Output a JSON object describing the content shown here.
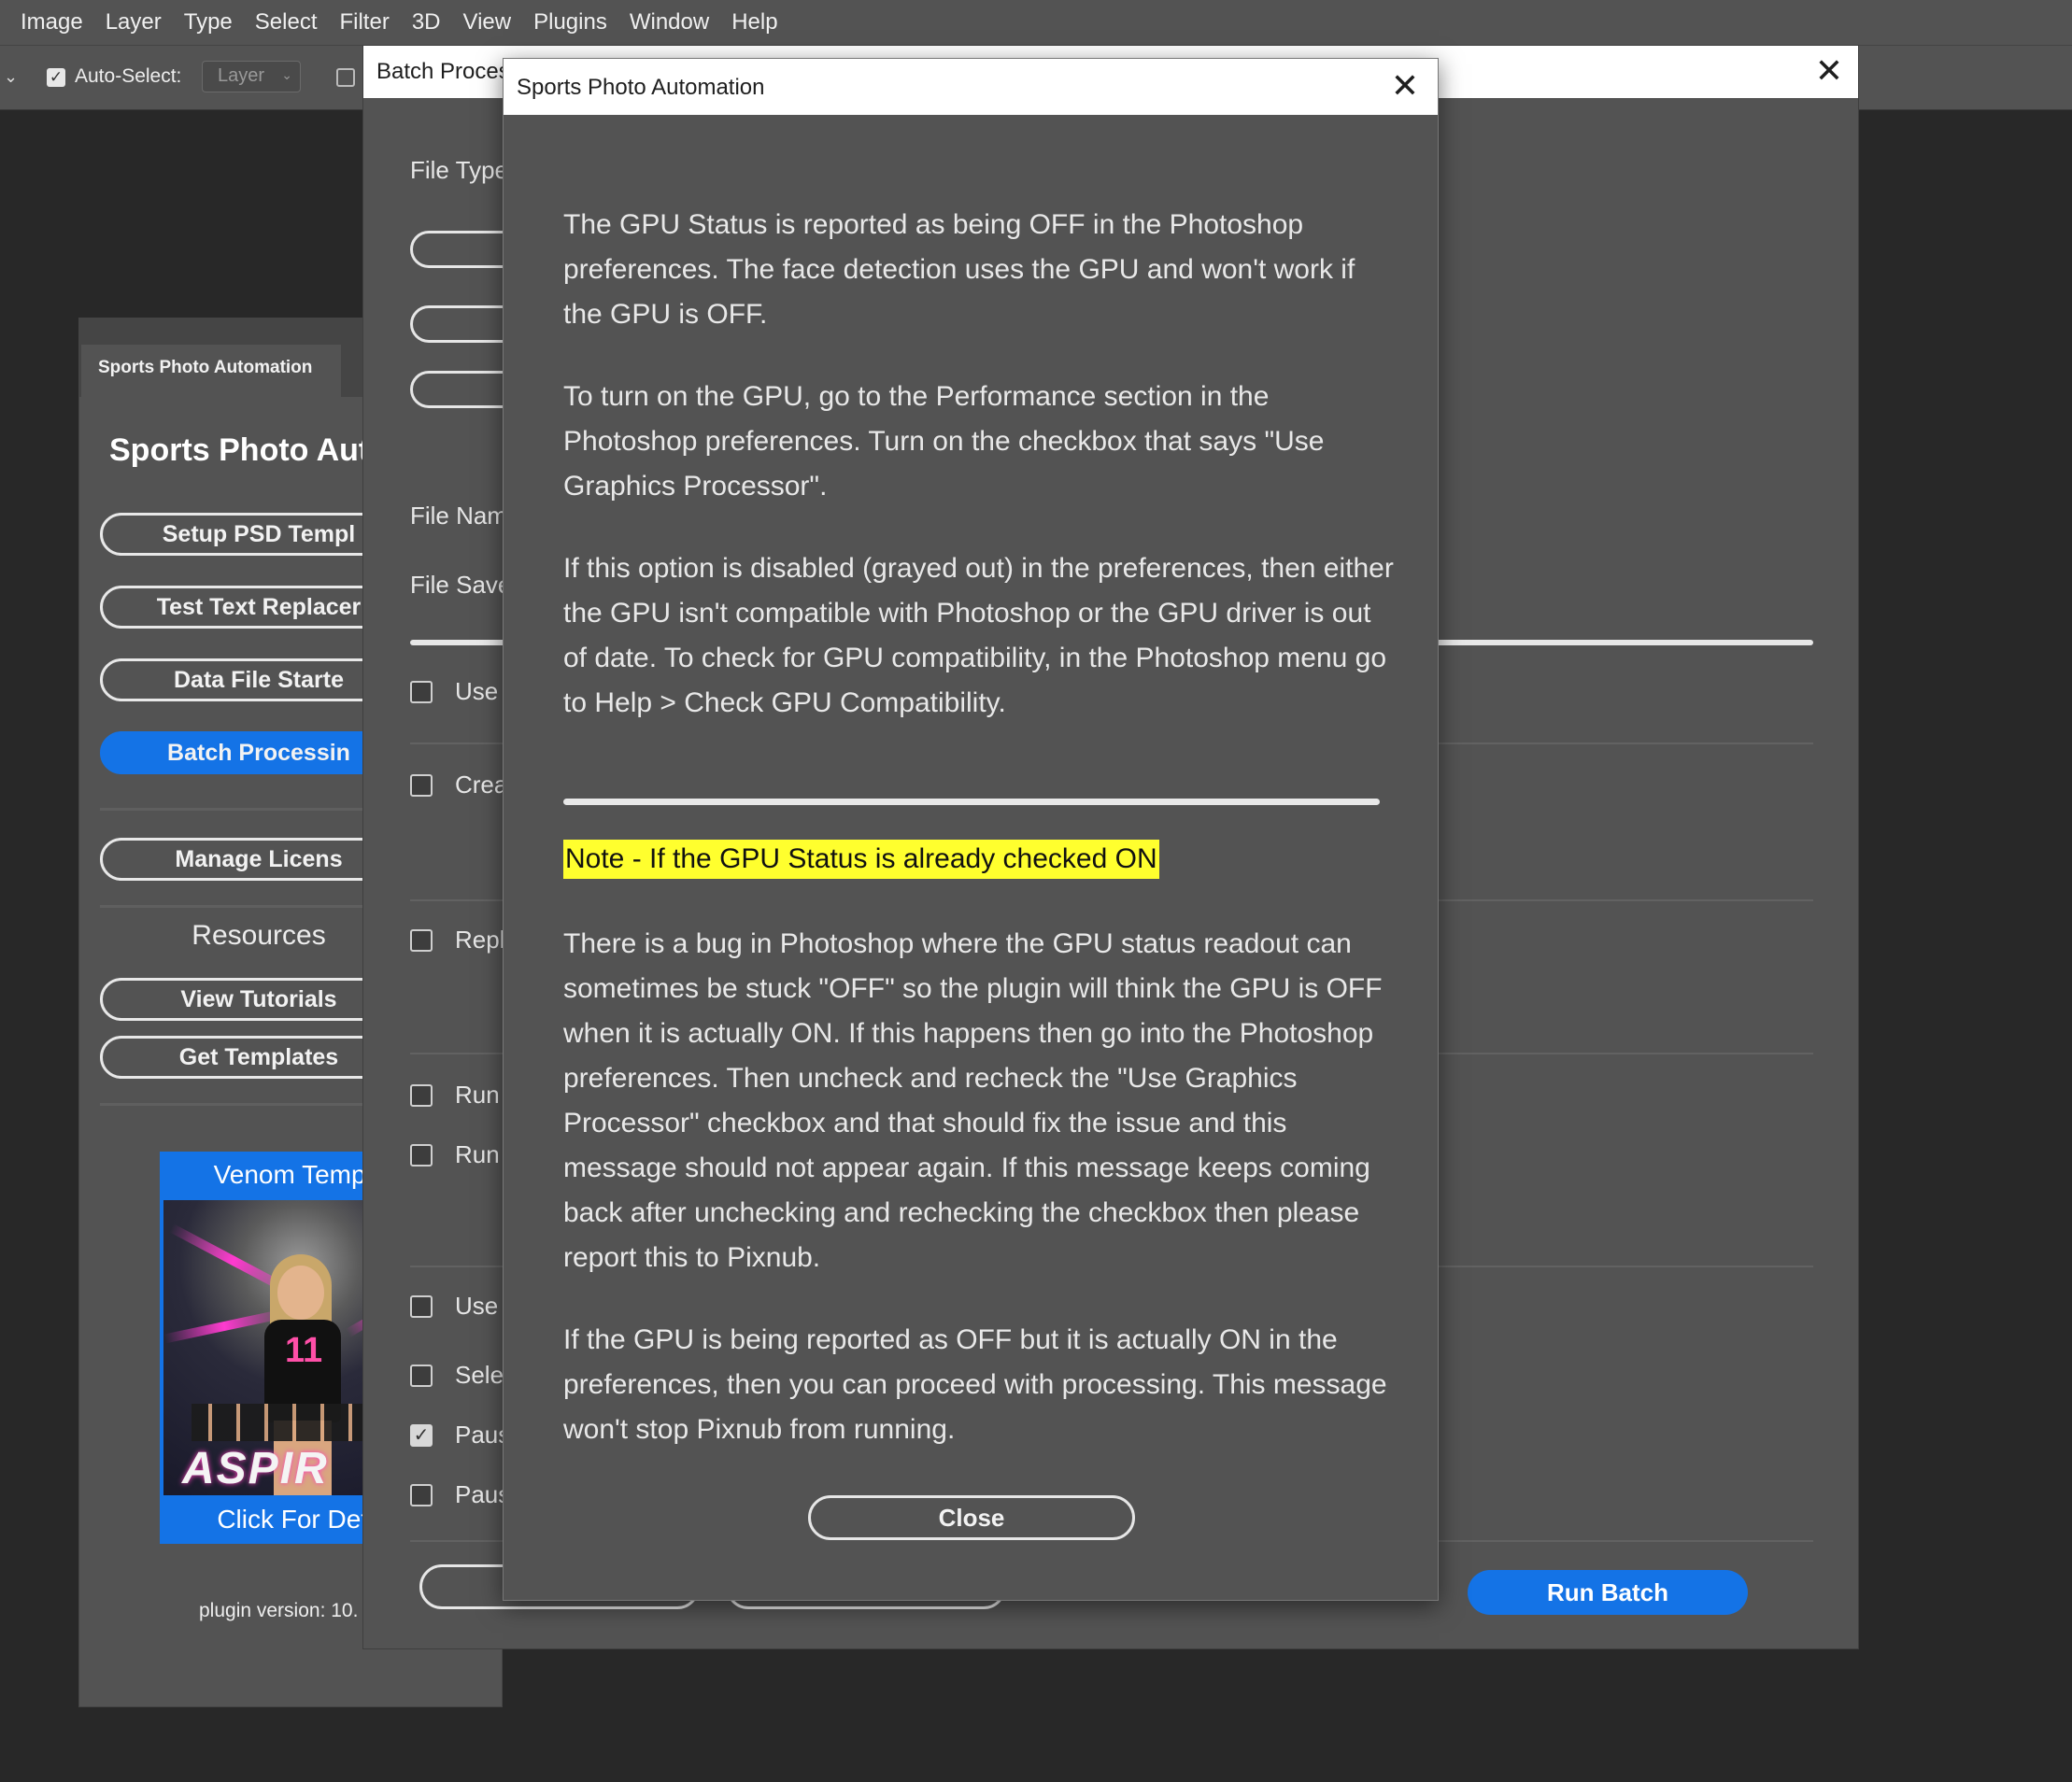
{
  "menubar": {
    "items": [
      "Image",
      "Layer",
      "Type",
      "Select",
      "Filter",
      "3D",
      "View",
      "Plugins",
      "Window",
      "Help"
    ]
  },
  "options_bar": {
    "auto_select_label": "Auto-Select:",
    "auto_select_checked": true,
    "layer_select_value": "Layer"
  },
  "plugin_panel": {
    "tab_label": "Sports Photo Automation",
    "heading": "Sports Photo Autc",
    "buttons": [
      {
        "label": "Setup PSD Templ"
      },
      {
        "label": "Test Text Replacer"
      },
      {
        "label": "Data File Starte"
      },
      {
        "label": "Batch Processin",
        "active": true
      },
      {
        "label": "Manage Licens"
      }
    ],
    "resources_label": "Resources",
    "resource_buttons": [
      "View Tutorials",
      "Get Templates"
    ],
    "promo": {
      "title": "Venom Templa",
      "cta": "Click For Deta",
      "image_text": "ASPIR"
    },
    "version": "plugin version: 10."
  },
  "batch_window": {
    "title": "Batch Proces",
    "labels": {
      "file_type": "File Type",
      "file_name": "File Nam",
      "file_save": "File Save"
    },
    "checkboxes": [
      {
        "label": "Use",
        "checked": false
      },
      {
        "label": "Crea",
        "checked": false
      },
      {
        "label": "Repl",
        "checked": false
      },
      {
        "label": "Run",
        "checked": false
      },
      {
        "label": "Run",
        "checked": false
      },
      {
        "label": "Use",
        "checked": false
      },
      {
        "label": "Selec",
        "checked": false
      },
      {
        "label": "Paus",
        "checked": true
      },
      {
        "label": "Paus",
        "checked": false
      }
    ],
    "run_batch_label": "Run Batch"
  },
  "modal": {
    "title": "Sports Photo Automation",
    "paragraphs": [
      "The GPU Status is reported as being OFF in the Photoshop preferences. The face detection uses the GPU and won't work if the GPU is OFF.",
      "To turn on the GPU, go to the Performance section in the Photoshop preferences. Turn on the checkbox that says \"Use Graphics Processor\".",
      "If this option is disabled (grayed out) in the preferences, then either the GPU isn't compatible with Photoshop or the GPU driver is out of date. To check for GPU compatibility, in the Photoshop menu go to Help > Check GPU Compatibility."
    ],
    "note": "Note - If the GPU Status is already checked ON",
    "note_color": "#ffff2e",
    "paragraphs_after_note": [
      "There is a bug in Photoshop where the GPU status readout can sometimes be stuck \"OFF\" so the plugin will think the GPU is OFF when it is actually ON. If this happens then go into the Photoshop preferences. Then uncheck and recheck the \"Use Graphics Processor\" checkbox and that should fix the issue and this message should not appear again. If this message keeps coming back after unchecking and rechecking the checkbox then please report this to Pixnub.",
      "If the GPU is being reported as OFF but it is actually ON in the preferences, then you can proceed with processing. This message won't stop Pixnub from running."
    ],
    "close_label": "Close"
  },
  "colors": {
    "accent_blue": "#1473e6",
    "panel_gray": "#535353",
    "canvas": "#282828"
  }
}
